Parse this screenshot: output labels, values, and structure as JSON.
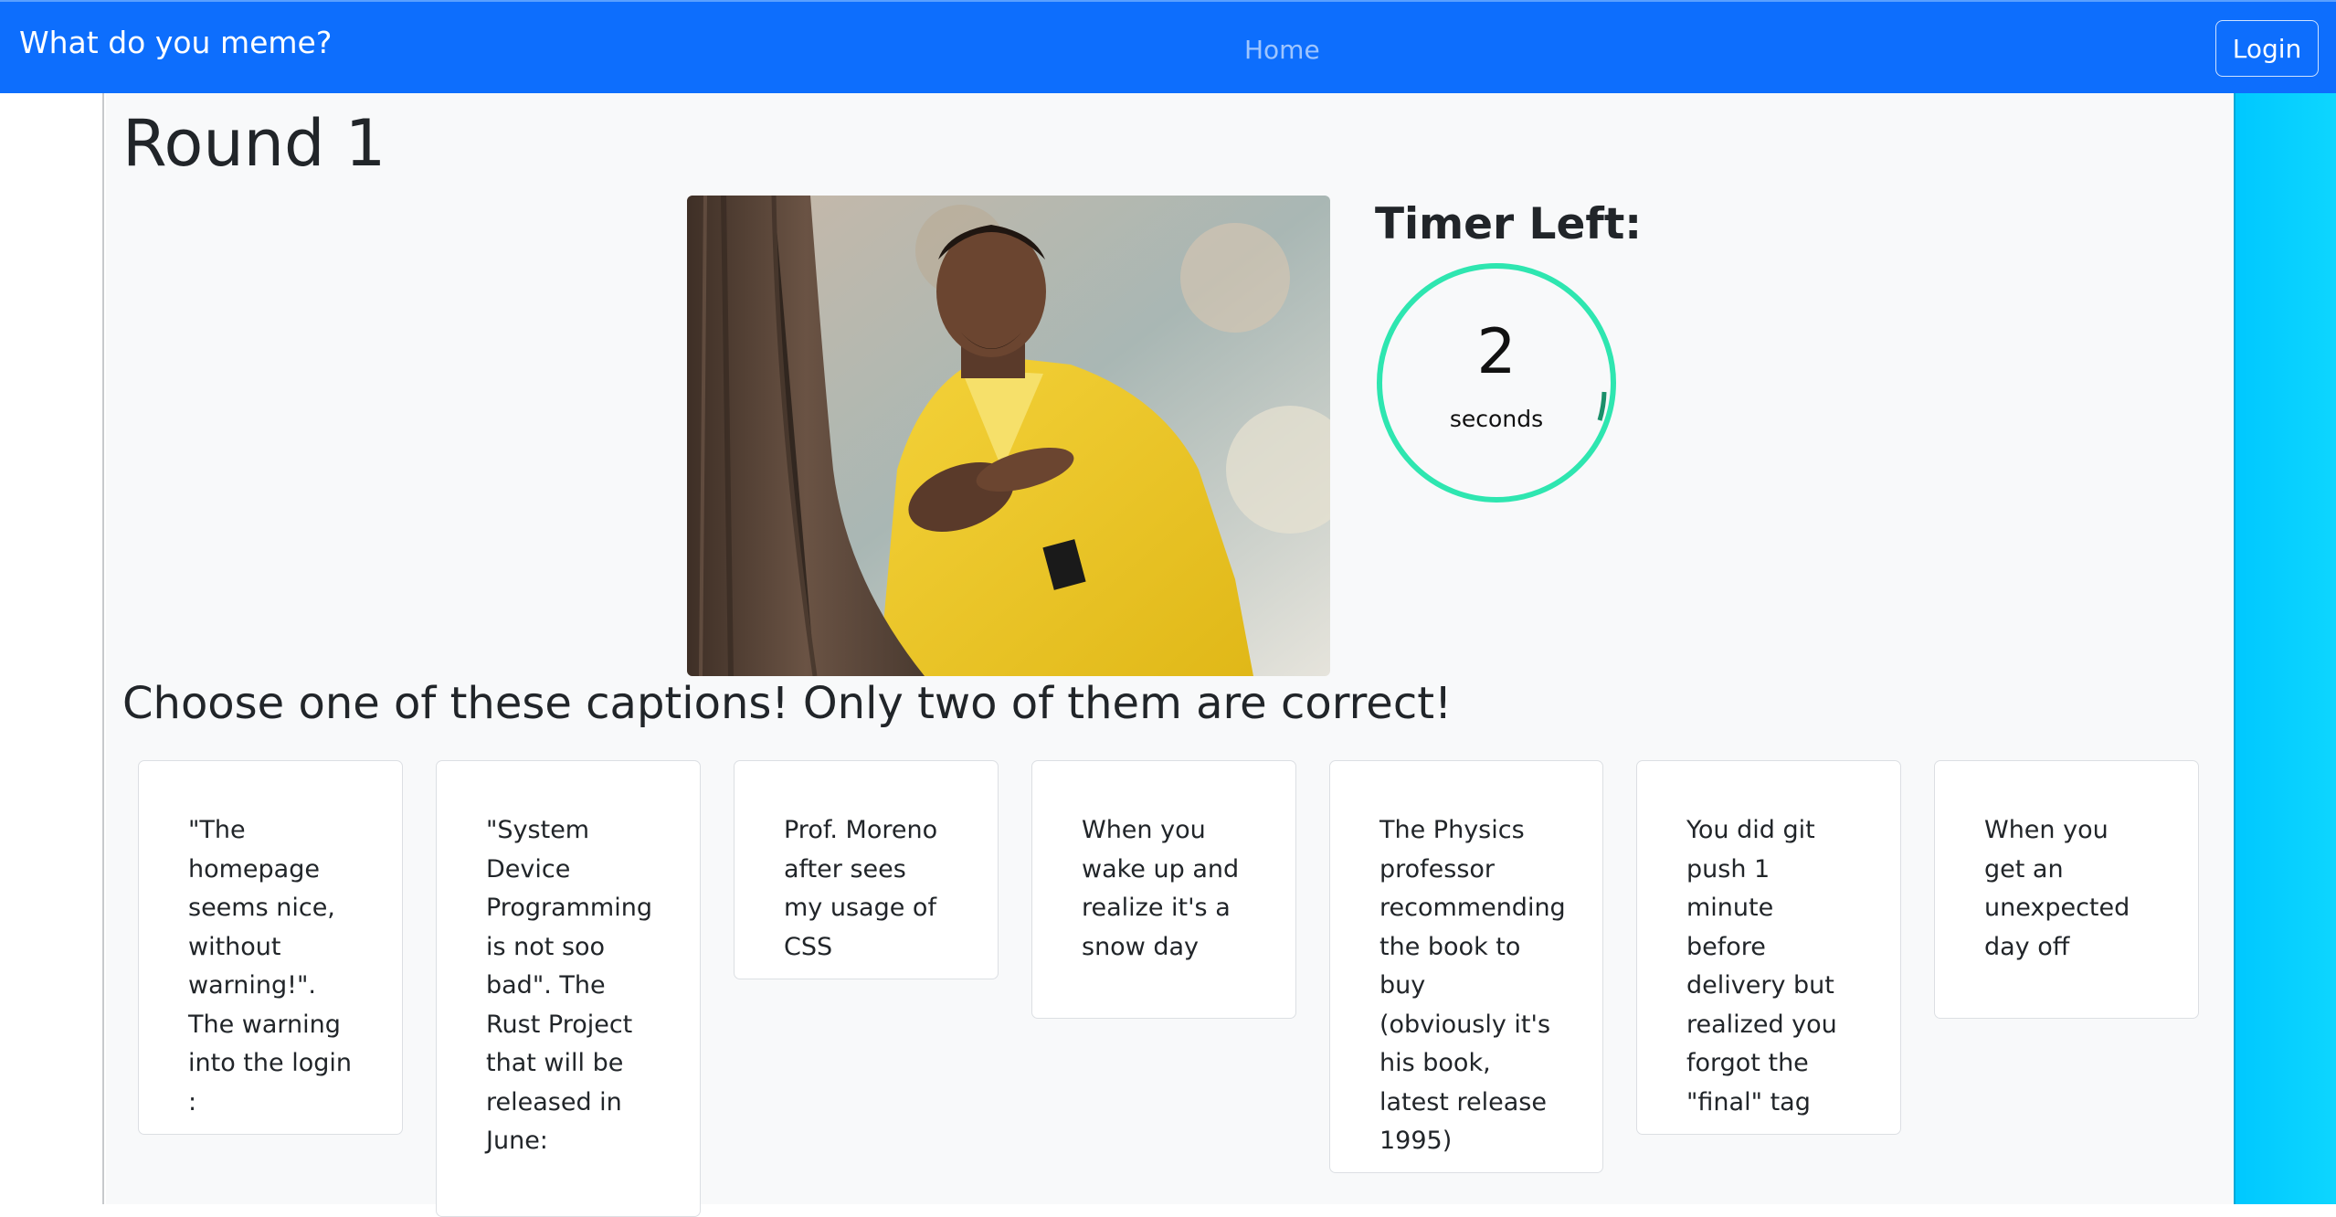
{
  "navbar": {
    "brand": "What do you meme?",
    "home_link": "Home",
    "login_label": "Login",
    "color": "#0d6efd"
  },
  "game": {
    "round_title": "Round 1",
    "meme_image": "man in yellow suit peeking from behind a tree rubbing his hands",
    "timer_label": "Timer Left:",
    "timer_value": "2",
    "timer_unit": "seconds",
    "timer_ring_color": "#2ee6b0",
    "timer_progress_color": "#1a8f6a",
    "instructions": "Choose one of these captions! Only two of them are correct!",
    "captions": [
      "\"The homepage seems nice, without warning!\". The warning into the login :",
      "\"System Device Programming is not soo bad\". The Rust Project that will be released in June:",
      "Prof. Moreno after sees my usage of CSS",
      "When you wake up and realize it's a snow day",
      "The Physics professor recommending the book to buy (obviously it's his book, latest release 1995)",
      "You did git push 1 minute before delivery but realized you forgot the \"final\" tag",
      "When you get an unexpected day off"
    ]
  }
}
